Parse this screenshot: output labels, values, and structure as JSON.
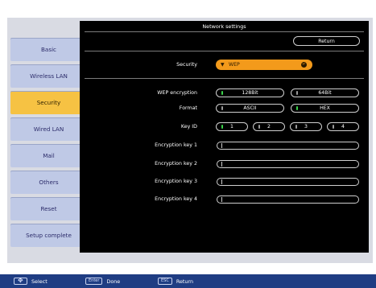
{
  "dialog_title": "Network settings",
  "return_button": "Return",
  "menu": [
    {
      "label": "Basic"
    },
    {
      "label": "Wireless LAN"
    },
    {
      "label": "Security",
      "active": true
    },
    {
      "label": "Wired LAN"
    },
    {
      "label": "Mail"
    },
    {
      "label": "Others"
    },
    {
      "label": "Reset"
    },
    {
      "label": "Setup complete"
    }
  ],
  "security": {
    "label": "Security",
    "value": "WEP"
  },
  "wep_encryption": {
    "label": "WEP encryption",
    "options": [
      "128Bit",
      "64Bit"
    ],
    "selected": "128Bit"
  },
  "format": {
    "label": "Format",
    "options": [
      "ASCII",
      "HEX"
    ],
    "selected": "HEX"
  },
  "key_id": {
    "label": "Key ID",
    "options": [
      "1",
      "2",
      "3",
      "4"
    ],
    "selected": "1"
  },
  "encryption_keys": [
    {
      "label": "Encryption key 1",
      "value": ""
    },
    {
      "label": "Encryption key 2",
      "value": ""
    },
    {
      "label": "Encryption key 3",
      "value": ""
    },
    {
      "label": "Encryption key 4",
      "value": ""
    }
  ],
  "bottom_bar": {
    "select": {
      "key": "",
      "label": "Select"
    },
    "done": {
      "key": "Enter",
      "label": "Done"
    },
    "return": {
      "key": "ESC",
      "label": "Return"
    }
  },
  "colors": {
    "accent": "#f39a1b",
    "active_menu": "#f6c243",
    "menu": "#bfc9e6",
    "bar": "#1f3d83"
  }
}
